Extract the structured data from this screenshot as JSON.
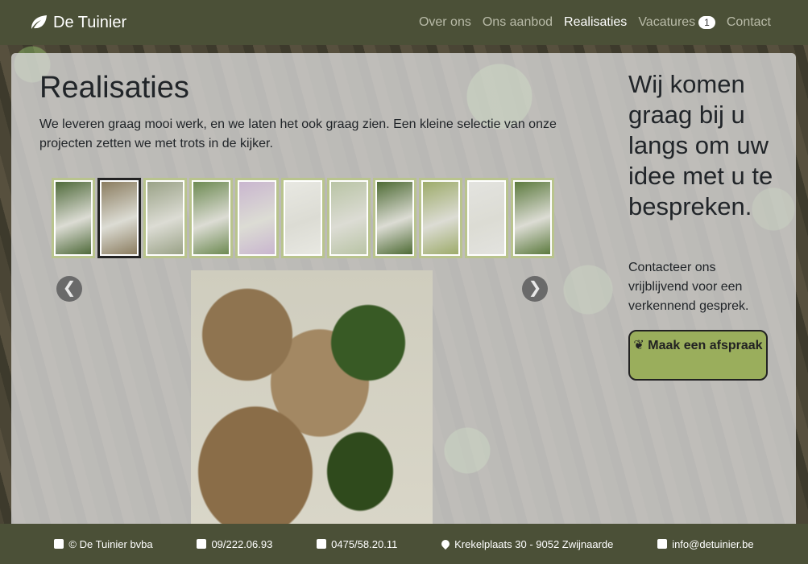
{
  "navbar": {
    "brand": "De Tuinier",
    "items": [
      {
        "label": "Over ons"
      },
      {
        "label": "Ons aanbod"
      },
      {
        "label": "Realisaties"
      },
      {
        "label": "Vacatures"
      },
      {
        "label": "Contact"
      }
    ],
    "vacatures_badge": "1"
  },
  "main": {
    "title": "Realisaties",
    "intro": "We leveren graag mooi werk, en we laten het ook graag zien. Een kleine selectie van onze projecten zetten we met trots in de kijker.",
    "thumbnail_colors": [
      "#4f6a3a",
      "#8b7d60",
      "#9aa287",
      "#6d8a52",
      "#c9b6cf",
      "#e8e8e2",
      "#b9c4a5",
      "#4e6b34",
      "#9dab6a",
      "#e3e3df",
      "#5c7a3e"
    ],
    "arrow_prev": "❮",
    "arrow_next": "❯"
  },
  "cta": {
    "title": "Wij komen graag bij u langs om uw idee met u te bespreken.",
    "text": "Contacteer ons vrijblijvend voor een verkennend gesprek.",
    "button_label": "Maak een afspraak"
  },
  "footer": {
    "company": "© De Tuinier bvba",
    "phone": "09/222.06.93",
    "mobile": "0475/58.20.11",
    "address": "Krekelplaats 30 - 9052 Zwijnaarde",
    "email": "info@detuinier.be"
  },
  "colors": {
    "nav_bg": "#4b5037",
    "accent": "#9aae5c",
    "thumb_border": "#b9c48d"
  }
}
